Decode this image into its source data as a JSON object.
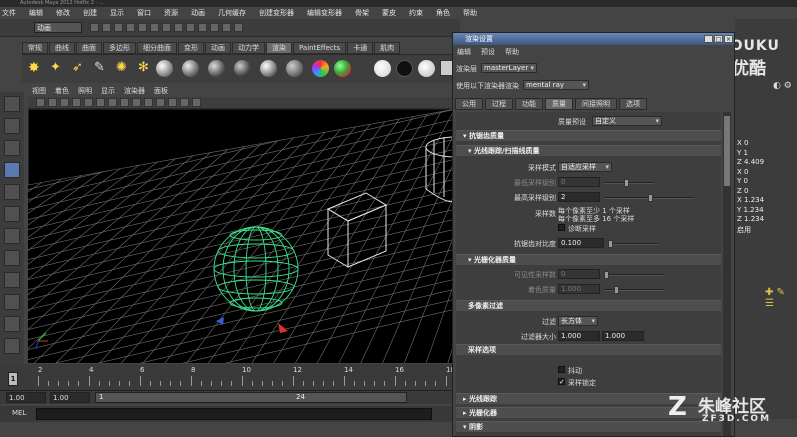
{
  "app": {
    "title": "Autodesk Maya 2012 Hotfix 2 - ...",
    "menus": [
      "文件",
      "编辑",
      "修改",
      "创建",
      "显示",
      "窗口",
      "资源",
      "动画",
      "几何缓存",
      "创建变形器",
      "编辑变形器",
      "骨架",
      "蒙皮",
      "约束",
      "角色",
      "帮助"
    ],
    "mode": "动画"
  },
  "shelf": {
    "tabs": [
      "常规",
      "曲线",
      "曲面",
      "多边形",
      "细分曲面",
      "变形",
      "动画",
      "动力学",
      "渲染",
      "PaintEffects",
      "卡通",
      "肌肉"
    ],
    "active_tab": "渲染"
  },
  "panel": {
    "menus": [
      "视图",
      "着色",
      "照明",
      "显示",
      "渲染器",
      "面板"
    ]
  },
  "timeline": {
    "ticks": [
      "1",
      "2",
      "4",
      "6",
      "8",
      "10",
      "12",
      "14",
      "16",
      "18"
    ],
    "current": "1"
  },
  "range": {
    "start": "1.00",
    "start2": "1.00",
    "slider_start": "1",
    "slider_end": "24"
  },
  "command_line": {
    "label": "MEL"
  },
  "channel_box": {
    "values": [
      "X 0",
      "Y 1",
      "Z 4.409",
      "X 0",
      "Y 0",
      "Z 0",
      "X 1.234",
      "Y 1.234",
      "Z 1.234",
      "启用"
    ]
  },
  "dialog": {
    "title": "渲染设置",
    "menus": [
      "编辑",
      "预设",
      "帮助"
    ],
    "layer_label": "渲染层",
    "layer_value": "masterLayer",
    "renderer_label": "使用以下渲染器渲染",
    "renderer_value": "mental ray",
    "tabs": [
      "公用",
      "过程",
      "功能",
      "质量",
      "间接照明",
      "选项"
    ],
    "active_tab": "质量",
    "quality_preset_label": "质量预设",
    "quality_preset_value": "自定义",
    "sections": {
      "antialias": "抗锯齿质量",
      "raytrace_scan": "光线跟踪/扫描线质量",
      "rasterizer": "光栅化器质量",
      "multipixel": "多像素过滤",
      "sample_options": "采样选项",
      "raytracing": "光线跟踪",
      "rasterizer2": "光栅化器",
      "shadows": "阴影"
    },
    "sample_mode_label": "采样模式",
    "sample_mode_value": "自适应采样",
    "min_sample_label": "最低采样级别",
    "min_sample_value": "0",
    "max_sample_label": "最高采样级别",
    "max_sample_value": "2",
    "samples_label": "采样数",
    "samples_line1": "每个像素至少 1 个采样",
    "samples_line2": "每个像素至多 16 个采样",
    "diag_samples_label": "诊断采样",
    "contrast_label": "抗锯齿对比度",
    "contrast_value": "0.100",
    "visibility_label": "可见性采样数",
    "visibility_value": "0",
    "shading_label": "着色质量",
    "shading_value": "1.000",
    "filter_label": "过滤",
    "filter_value": "长方体",
    "filter_size_label": "过滤器大小",
    "filter_size_x": "1.000",
    "filter_size_y": "1.000",
    "jitter_label": "抖动",
    "lock_samples_label": "采样锁定"
  },
  "watermarks": {
    "youku_en": "YOUKU",
    "youku_cn": "优酷",
    "site_cn": "朱峰社区",
    "site_url": "ZF3D.COM"
  },
  "colors": {
    "viewport_bg": "#000000",
    "sphere": "#39e58a",
    "grid": "#707070",
    "dialog_title": "#4c6a98"
  }
}
